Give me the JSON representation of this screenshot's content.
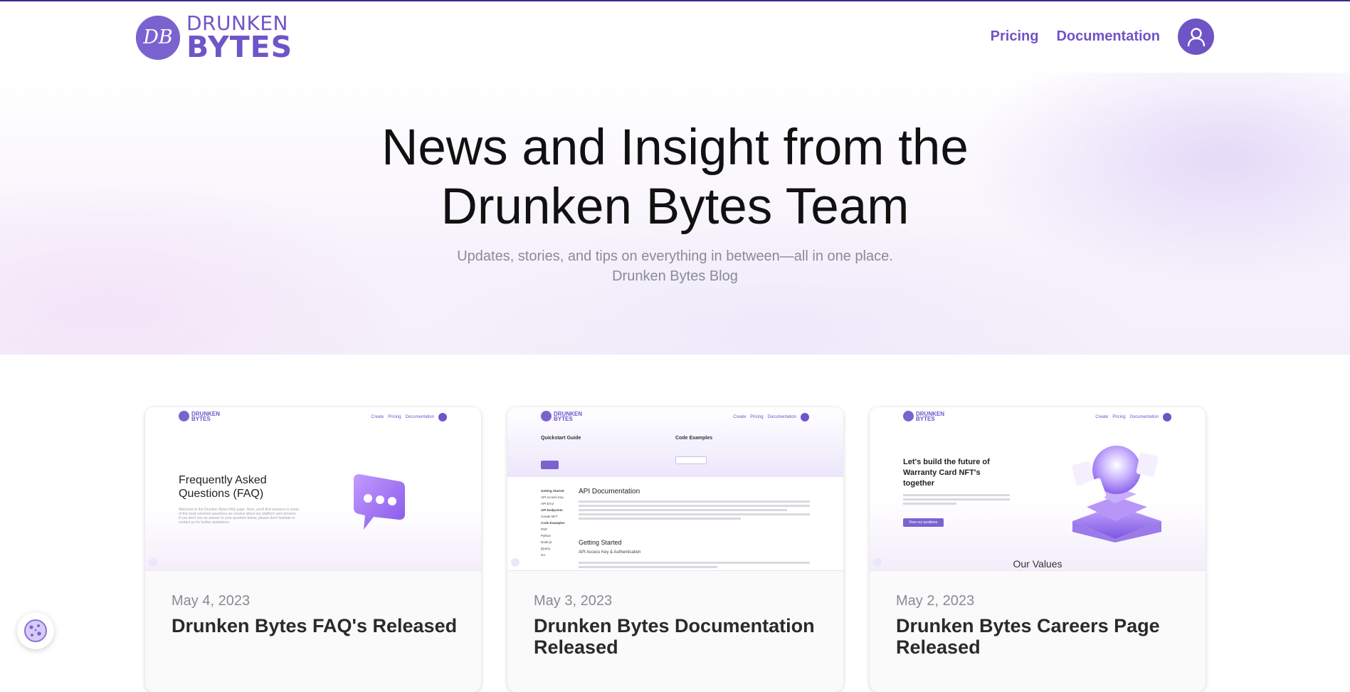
{
  "brand": {
    "badge": "DB",
    "line1": "DRUNKEN",
    "line2": "BYTES"
  },
  "nav": {
    "pricing": "Pricing",
    "documentation": "Documentation"
  },
  "hero": {
    "title_line1": "News and Insight from the",
    "title_line2": "Drunken Bytes Team",
    "subtitle": "Updates, stories, and tips on everything in between—all in one place.",
    "blog_label": "Drunken Bytes Blog"
  },
  "mini": {
    "create": "Create",
    "pricing": "Pricing",
    "documentation": "Documentation"
  },
  "posts": [
    {
      "date": "May 4, 2023",
      "title": "Drunken Bytes FAQ's Released",
      "preview": {
        "heading": "Frequently Asked Questions (FAQ)",
        "body": "Welcome to the Drunken Bytes FAQ page. Here, you'll find answers to some of the most common questions we receive about our platform and services. If you don't see an answer to your question below, please don't hesitate to contact us for further assistance."
      }
    },
    {
      "date": "May 3, 2023",
      "title": "Drunken Bytes Documentation Released",
      "preview": {
        "quickstart": "Quickstart Guide",
        "code_examples": "Code Examples",
        "heading": "API Documentation",
        "getting_started": "Getting Started",
        "auth": "API Access Key & Authentication",
        "sidebar": [
          "Getting Started",
          "API Access Key",
          "API Error",
          "API Endpoints",
          "Create NFT",
          "Code Examples",
          "PHP",
          "Python",
          "Node.js",
          "jQuery",
          "Go"
        ]
      }
    },
    {
      "date": "May 2, 2023",
      "title": "Drunken Bytes Careers Page Released",
      "preview": {
        "heading": "Let's build the future of Warranty Card NFT's together",
        "button": "View our positions",
        "values": "Our Values"
      }
    }
  ],
  "colors": {
    "accent": "#6f54c6",
    "brand_badge": "#7a63cf",
    "topline": "#3b2a8f"
  }
}
